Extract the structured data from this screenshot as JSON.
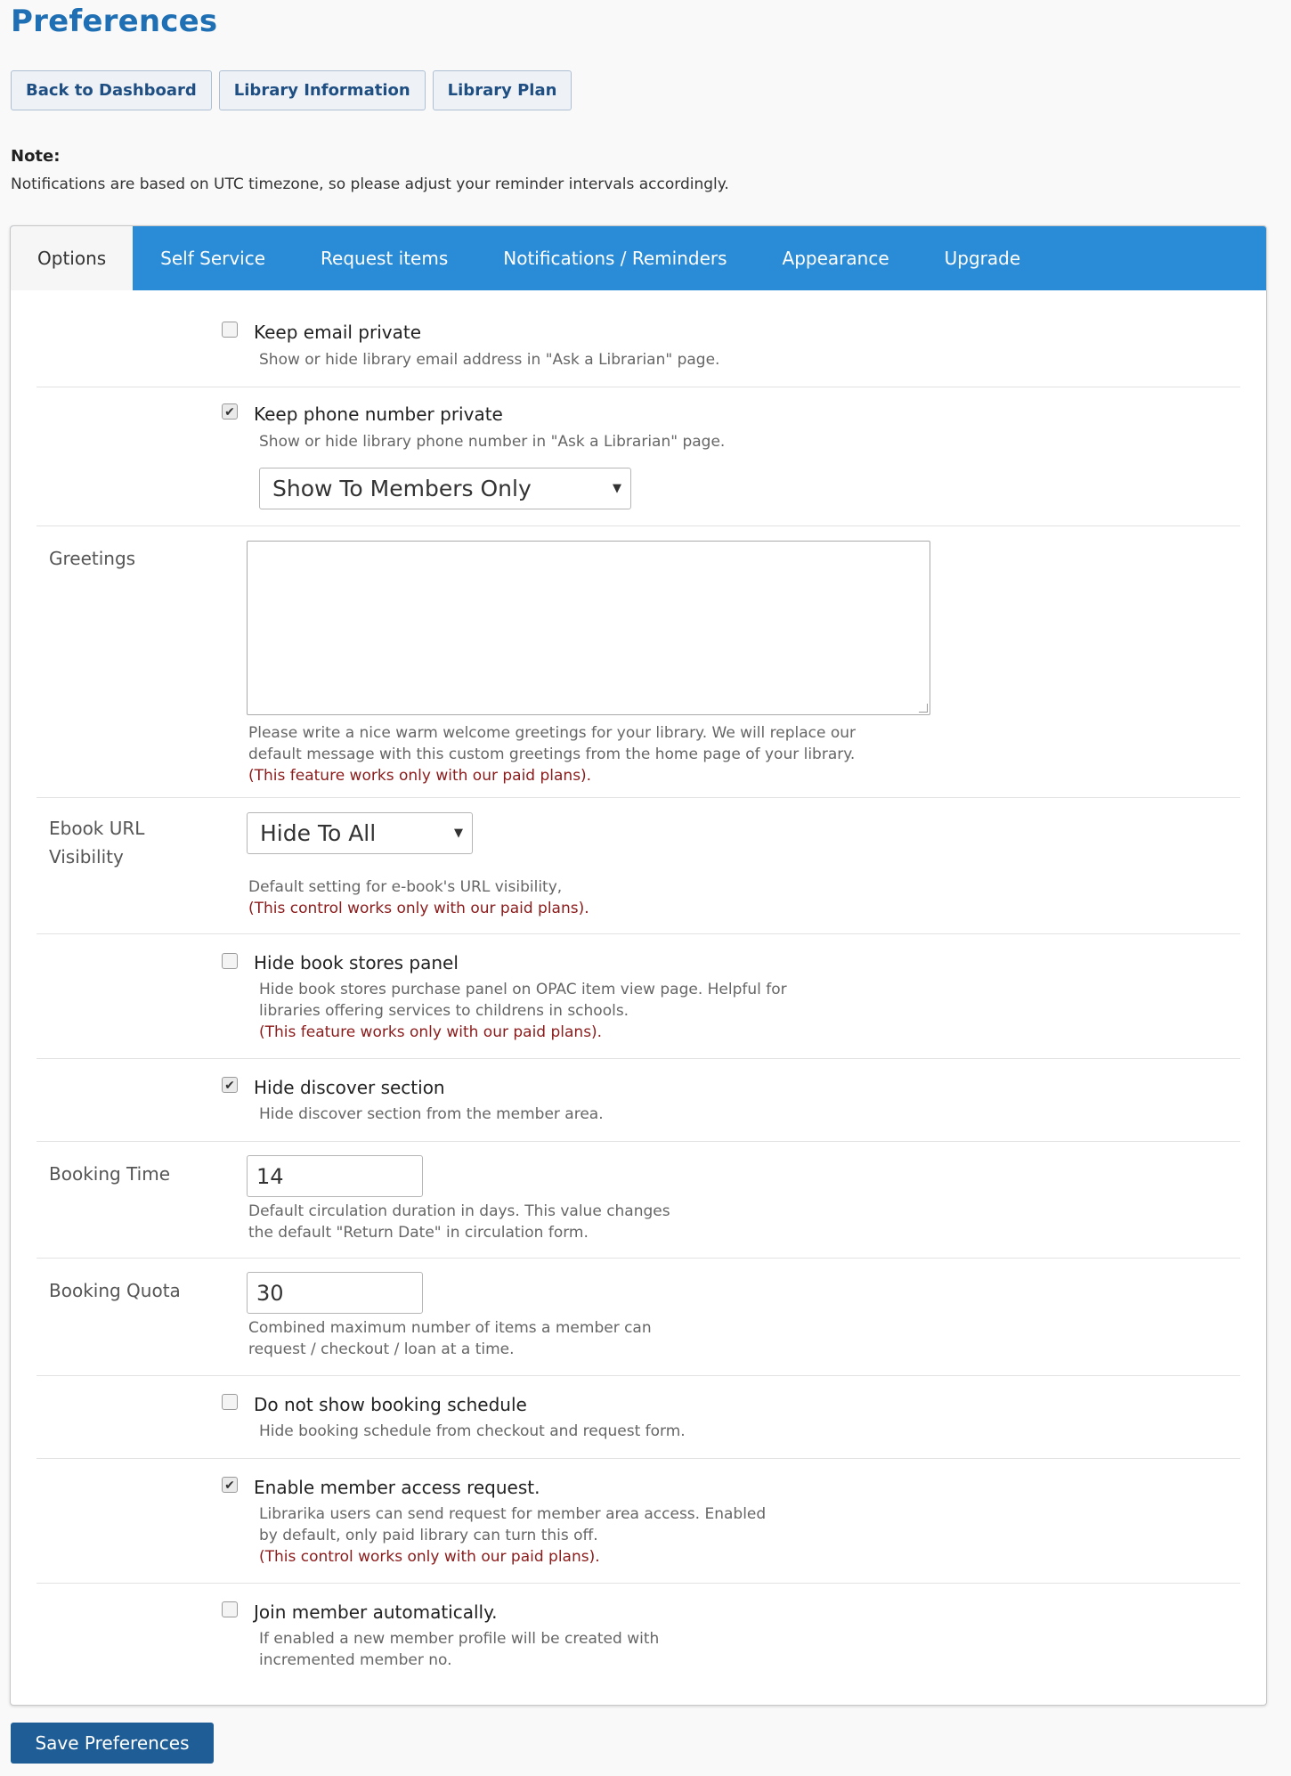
{
  "page": {
    "title": "Preferences"
  },
  "top_nav": [
    {
      "label": "Back to Dashboard"
    },
    {
      "label": "Library Information"
    },
    {
      "label": "Library Plan"
    }
  ],
  "note": {
    "label": "Note:",
    "text": "Notifications are based on UTC timezone, so please adjust your reminder intervals accordingly."
  },
  "tabs": [
    {
      "label": "Options",
      "active": true
    },
    {
      "label": "Self Service"
    },
    {
      "label": "Request items"
    },
    {
      "label": "Notifications / Reminders"
    },
    {
      "label": "Appearance"
    },
    {
      "label": "Upgrade"
    }
  ],
  "options": {
    "keep_email": {
      "label": "Keep email private",
      "checked": false,
      "help": "Show or hide library email address in \"Ask a Librarian\" page."
    },
    "keep_phone": {
      "label": "Keep phone number private",
      "checked": true,
      "help": "Show or hide library phone number in \"Ask a Librarian\" page.",
      "select_value": "Show To Members Only"
    },
    "greetings": {
      "label": "Greetings",
      "value": "",
      "help1": "Please write a nice warm welcome greetings for your library. We will replace our",
      "help2": "default message with this custom greetings from the home page of your library.",
      "warn": "(This feature works only with our paid plans)."
    },
    "ebook_url": {
      "label1": "Ebook URL",
      "label2": "Visibility",
      "select_value": "Hide To All",
      "help": "Default setting for e-book's URL visibility,",
      "warn": "(This control works only with our paid plans)."
    },
    "hide_book_stores": {
      "label": "Hide book stores panel",
      "checked": false,
      "help1": "Hide book stores purchase panel on OPAC item view page. Helpful for",
      "help2": "libraries offering services to childrens in schools.",
      "warn": "(This feature works only with our paid plans)."
    },
    "hide_discover": {
      "label": "Hide discover section",
      "checked": true,
      "help": "Hide discover section from the member area."
    },
    "booking_time": {
      "label": "Booking Time",
      "value": "14",
      "help1": "Default circulation duration in days. This value changes",
      "help2": "the default \"Return Date\" in circulation form."
    },
    "booking_quota": {
      "label": "Booking Quota",
      "value": "30",
      "help1": "Combined maximum number of items a member can",
      "help2": "request / checkout / loan at a time."
    },
    "no_booking_schedule": {
      "label": "Do not show booking schedule",
      "checked": false,
      "help": "Hide booking schedule from checkout and request form."
    },
    "member_access": {
      "label": "Enable member access request.",
      "checked": true,
      "help1": "Librarika users can send request for member area access. Enabled",
      "help2": "by default, only paid library can turn this off.",
      "warn": "(This control works only with our paid plans)."
    },
    "join_auto": {
      "label": "Join member automatically.",
      "checked": false,
      "help1": "If enabled a new member profile will be created with",
      "help2": "incremented member no."
    }
  },
  "save_button": {
    "label": "Save Preferences"
  },
  "glyphs": {
    "check": "✔",
    "arrow": "▼"
  }
}
